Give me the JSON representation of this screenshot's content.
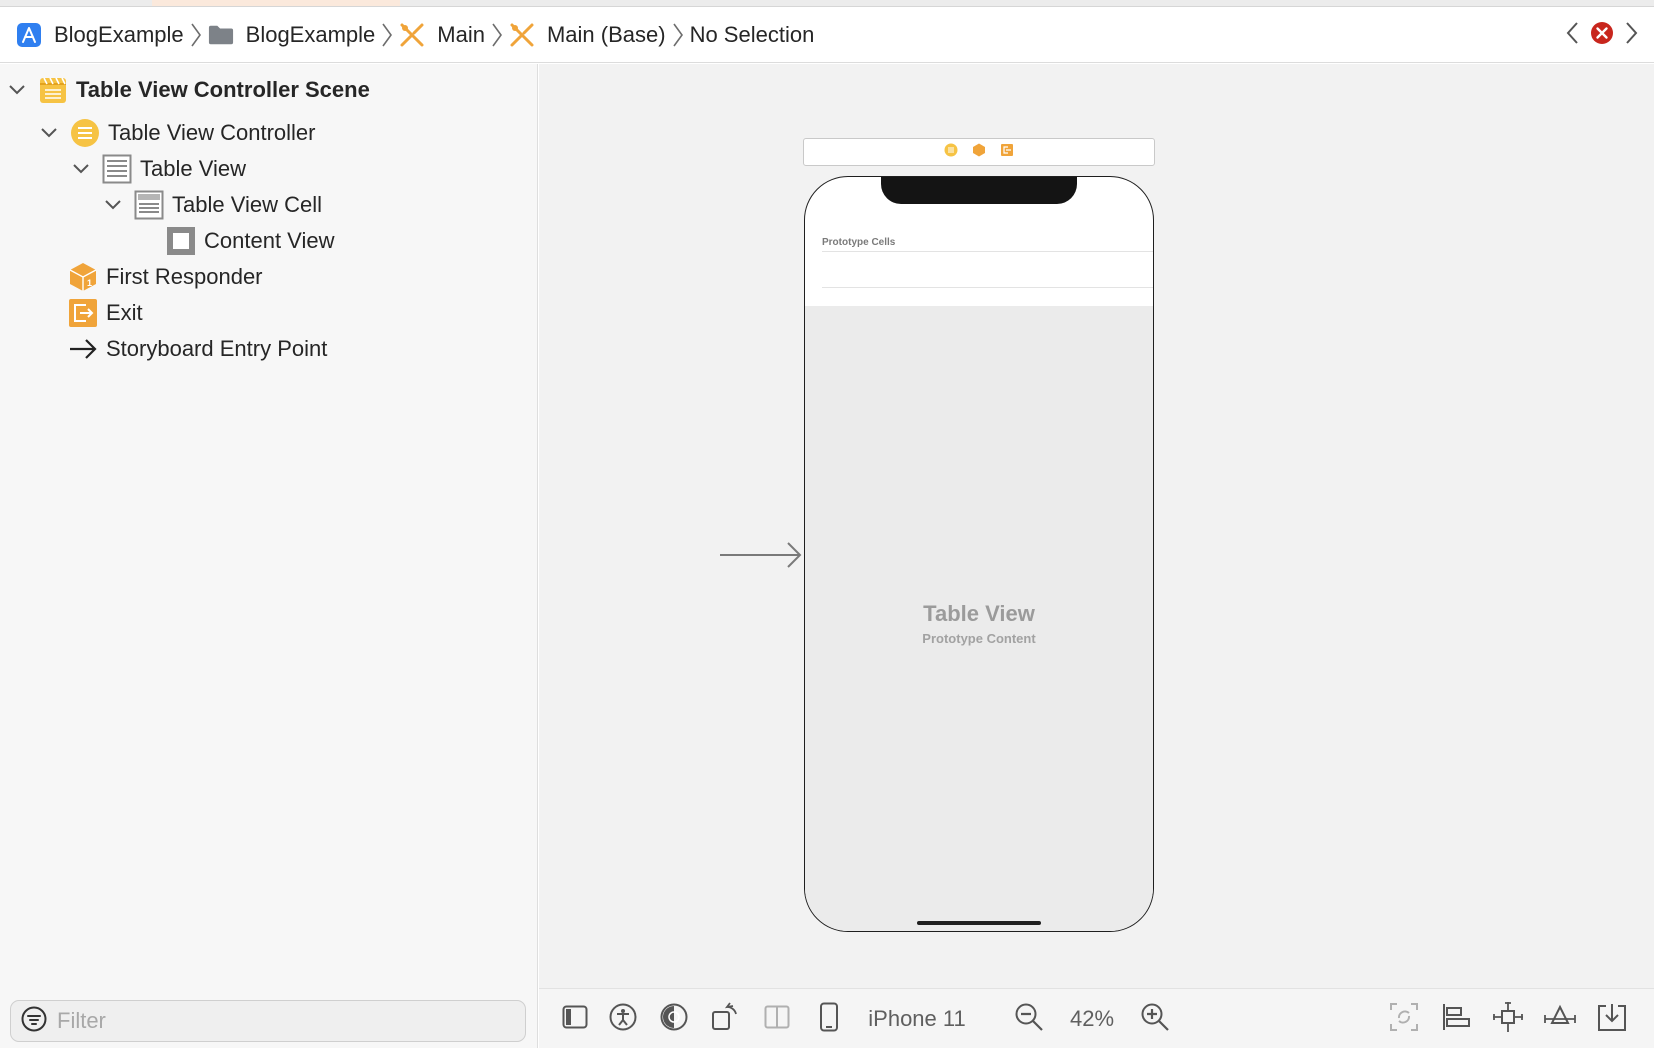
{
  "jumpbar": {
    "crumbs": [
      {
        "label": "BlogExample",
        "icon": "xcode-project-icon"
      },
      {
        "label": "BlogExample",
        "icon": "folder-icon"
      },
      {
        "label": "Main",
        "icon": "storyboard-icon"
      },
      {
        "label": "Main (Base)",
        "icon": "storyboard-icon"
      },
      {
        "label": "No Selection",
        "icon": ""
      }
    ],
    "error_color": "#c8261d"
  },
  "outline": {
    "items": [
      {
        "label": "Table View Controller Scene",
        "icon": "scene-icon",
        "expanded": true
      },
      {
        "label": "Table View Controller",
        "icon": "table-view-controller-icon",
        "expanded": true
      },
      {
        "label": "Table View",
        "icon": "table-view-icon",
        "expanded": true
      },
      {
        "label": "Table View Cell",
        "icon": "table-view-cell-icon",
        "expanded": true
      },
      {
        "label": "Content View",
        "icon": "content-view-icon"
      },
      {
        "label": "First Responder",
        "icon": "first-responder-icon"
      },
      {
        "label": "Exit",
        "icon": "exit-icon"
      },
      {
        "label": "Storyboard Entry Point",
        "icon": "arrow-right-icon"
      }
    ],
    "filter_placeholder": "Filter"
  },
  "canvas": {
    "prototype_cells_label": "Prototype Cells",
    "table_view_title": "Table View",
    "table_view_subtitle": "Prototype Content"
  },
  "toolbar": {
    "device": "iPhone 11",
    "zoom": "42%"
  },
  "colors": {
    "accent_orange": "#f0a43a",
    "accent_yellow": "#f6c344",
    "project_blue": "#2f7ff0"
  }
}
